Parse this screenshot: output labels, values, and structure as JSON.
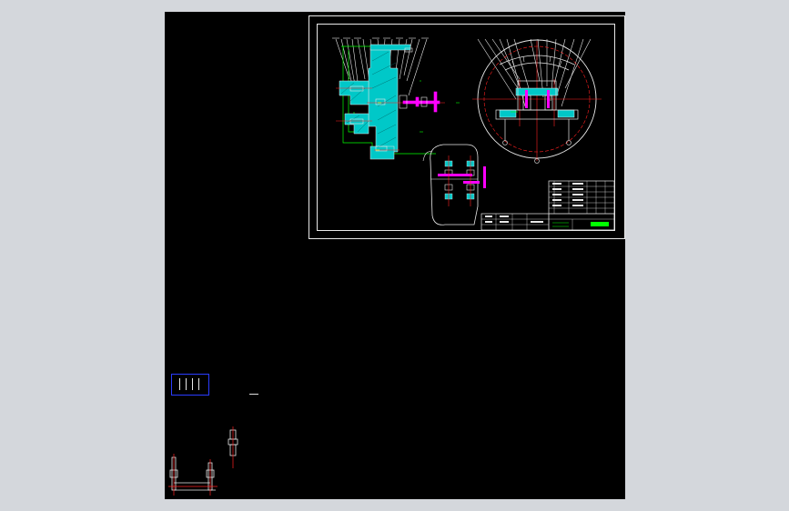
{
  "app": {
    "background_color": "#d4d7dc",
    "model_space_color": "#000000"
  },
  "drawing": {
    "layer_colors": {
      "outline": "#e8e8e8",
      "hatch": "#00c8c8",
      "dimension": "#00ff00",
      "center": "#ff2020",
      "part_magenta": "#ff00ff",
      "yellow": "#ffd700",
      "viewport_frame": "#2a3cff"
    },
    "title_block": {
      "label": "title-block"
    }
  }
}
